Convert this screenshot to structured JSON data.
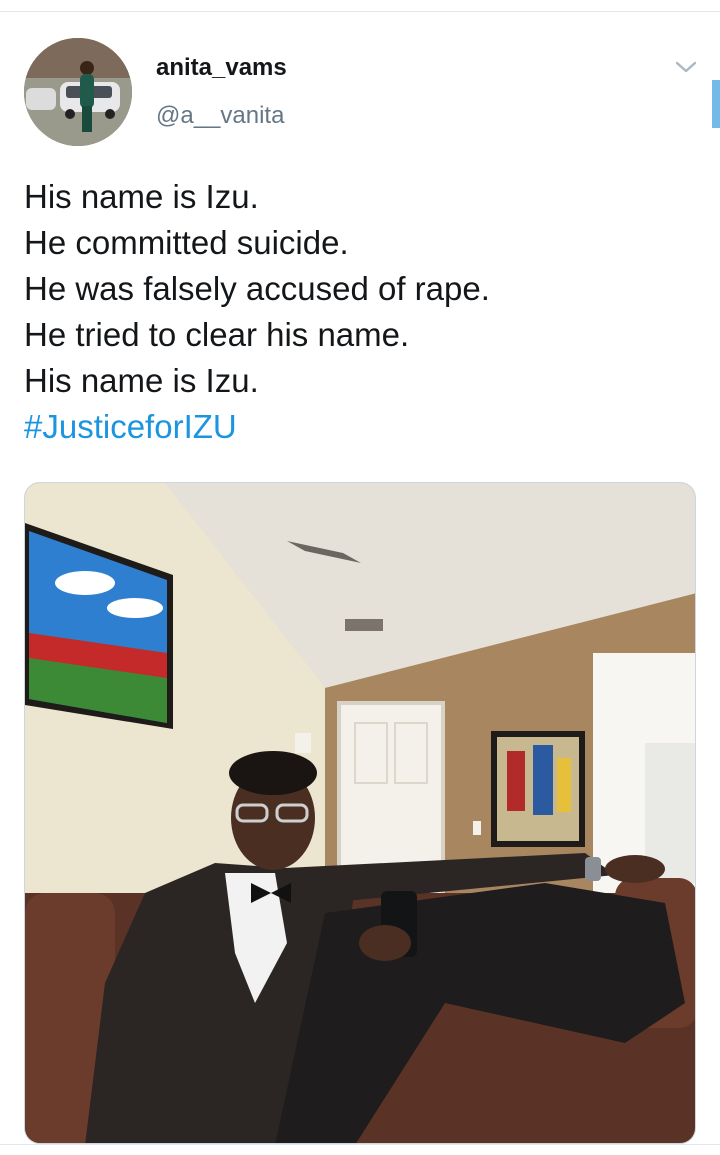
{
  "tweet": {
    "author": {
      "display_name": "anita_vams",
      "handle": "@a__vanita",
      "avatar_icon": "profile-photo"
    },
    "menu_icon": "chevron-down-icon",
    "text_lines": [
      "His name is Izu.",
      "He committed suicide.",
      "He was falsely accused of rape.",
      "He tried to clear his name.",
      "His name is Izu."
    ],
    "hashtag": "#JusticeforIZU",
    "media": {
      "type": "photo"
    }
  },
  "colors": {
    "text": "#14171a",
    "secondary_text": "#657786",
    "link": "#1b95e0",
    "divider": "#e1e8ed"
  }
}
